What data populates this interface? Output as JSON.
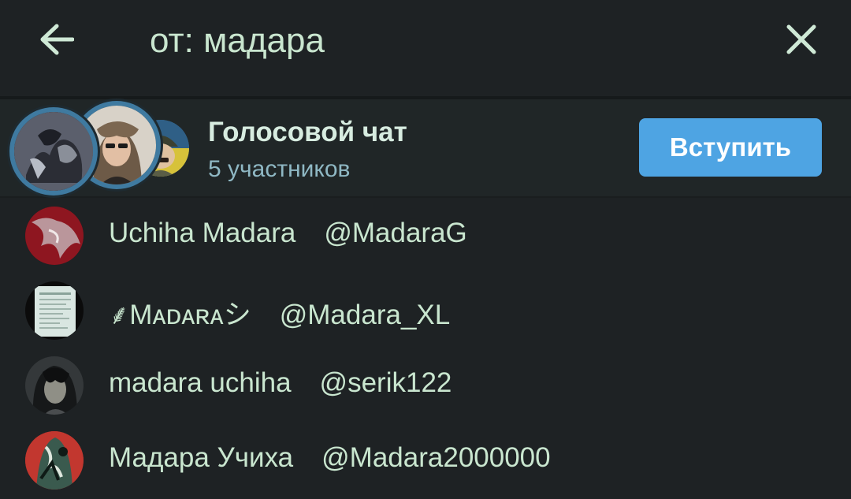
{
  "search": {
    "value": "от: мадара",
    "placeholder": "",
    "back_icon": "arrow-left-icon",
    "clear_icon": "close-icon"
  },
  "voice_chat": {
    "title": "Голосовой чат",
    "subtitle": "5 участников",
    "join_label": "Вступить",
    "accent_color": "#4ea4e3"
  },
  "results": [
    {
      "name": "Uchiha Madara",
      "handle": "@MadaraG"
    },
    {
      "name": "⸙Mᴀᴅᴀʀᴀシ",
      "handle": "@Madara_XL"
    },
    {
      "name": "madara uchiha",
      "handle": "@serik122"
    },
    {
      "name": "Мадара Учиха",
      "handle": "@Madara2000000"
    }
  ],
  "colors": {
    "background": "#1e2224",
    "banner": "#202627",
    "text": "#c9e6cf",
    "subtitle": "#8fb8c4",
    "speaking_ring": "#3f7aa0"
  }
}
